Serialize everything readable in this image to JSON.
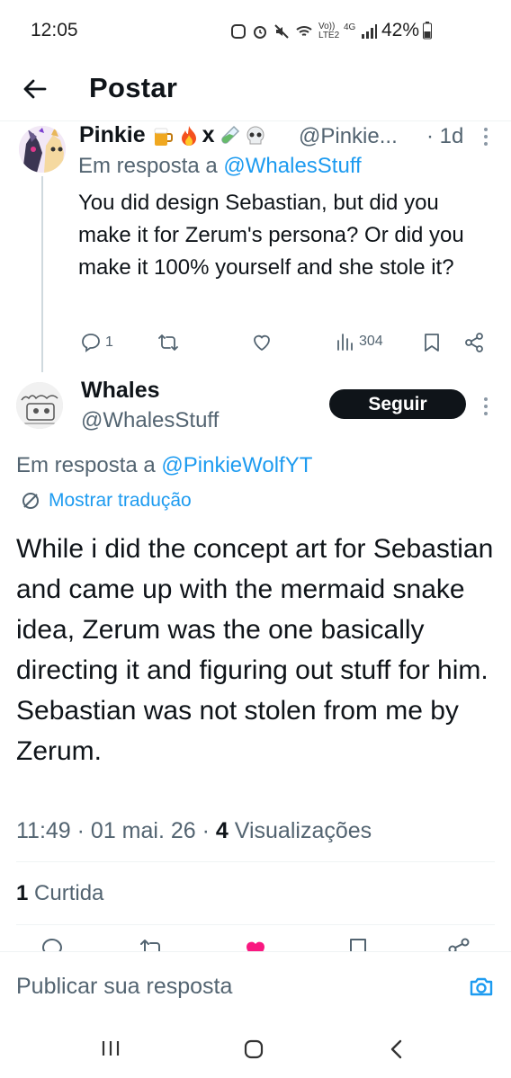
{
  "status_bar": {
    "time": "12:05",
    "network_label": "Vo)) LTE2",
    "network_gen": "4G",
    "battery": "42%"
  },
  "header": {
    "title": "Postar"
  },
  "reply_tweet": {
    "name": "Pinkie",
    "name_suffix": "x",
    "handle": "@Pinkie...",
    "time": "· 1d",
    "reply_to_prefix": "Em resposta a",
    "reply_to_handle": "@WhalesStuff",
    "text": "You did design Sebastian, but did you make it for Zerum's persona? Or did you make it 100% yourself and she stole it?",
    "replies": "1",
    "views": "304"
  },
  "main_tweet": {
    "name": "Whales",
    "handle": "@WhalesStuff",
    "follow_label": "Seguir",
    "reply_to_prefix": "Em resposta a",
    "reply_to_handle": "@PinkieWolfYT",
    "translate_label": "Mostrar tradução",
    "text": "While i did the concept art for Sebastian and came up with the mermaid snake idea, Zerum was the one basically directing it and figuring out stuff for him. Sebastian was not stolen from me by Zerum.",
    "time": "11:49 · 01 mai. 26 ·",
    "views_count": "4",
    "views_label": "Visualizações",
    "likes_count": "1",
    "likes_label": "Curtida"
  },
  "reply_bar": {
    "placeholder": "Publicar sua resposta"
  },
  "colors": {
    "accent": "#1d9bf0",
    "text": "#0f1419",
    "muted": "#536471",
    "like_active": "#f91880"
  },
  "icons": [
    "back-arrow-icon",
    "more-icon",
    "reply-icon",
    "retweet-icon",
    "like-icon",
    "views-icon",
    "bookmark-icon",
    "share-icon",
    "translate-icon",
    "camera-icon"
  ]
}
